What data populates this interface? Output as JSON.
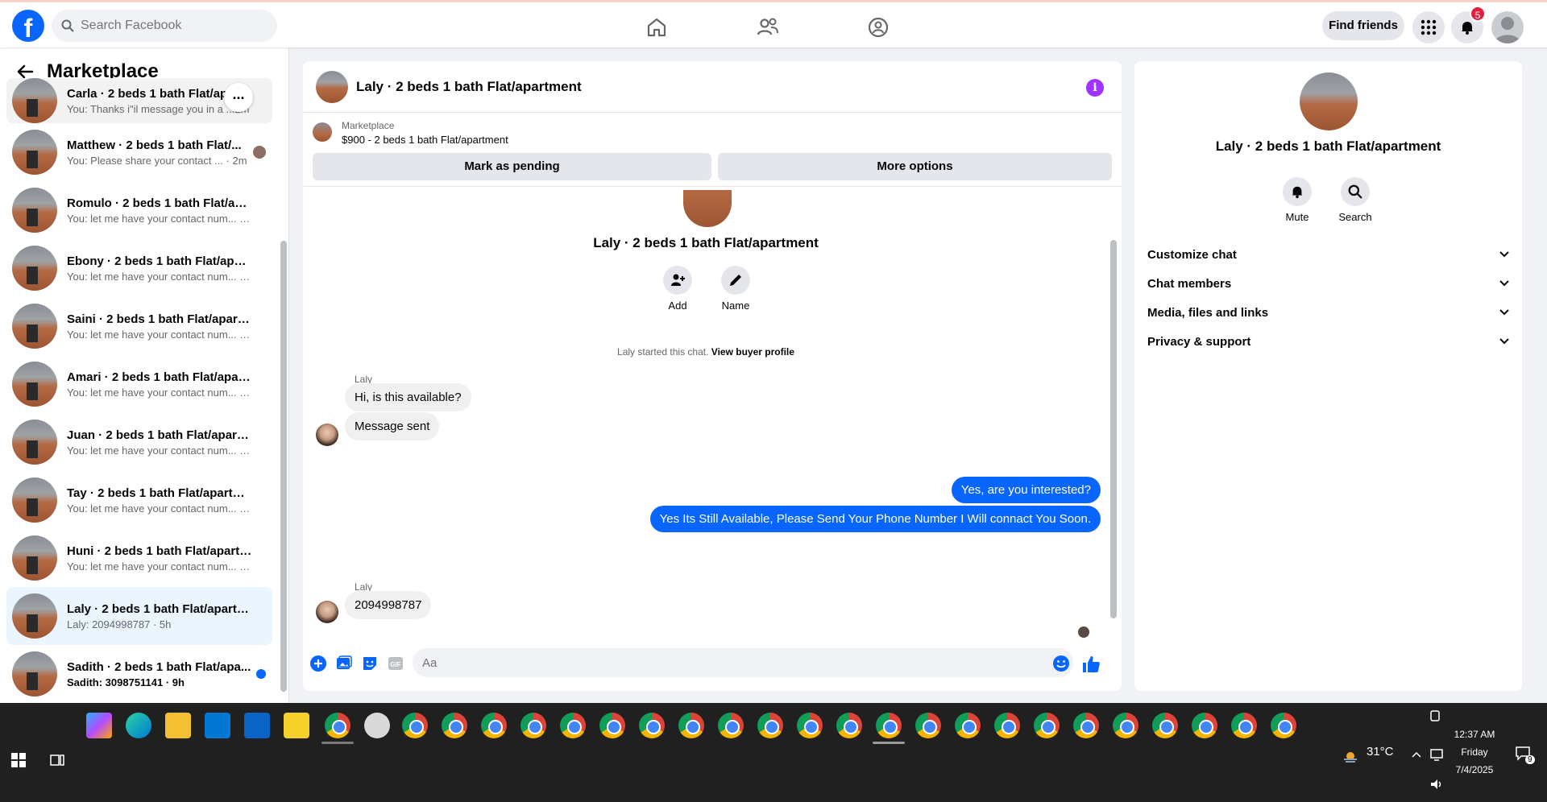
{
  "topbar": {
    "search_placeholder": "Search Facebook",
    "find_friends": "Find friends",
    "notification_count": "5",
    "logo_letter": "f"
  },
  "sidebar": {
    "title": "Marketplace",
    "conversations": [
      {
        "title": "Carla · 2 beds 1 bath Flat/apar...",
        "sub": "You: Thanks i\"il message you in a ...2m"
      },
      {
        "title": "Matthew · 2 beds 1 bath Flat/...",
        "sub": "You: Please share your contact ... · 2m"
      },
      {
        "title": "Romulo · 2 beds 1 bath Flat/apar...",
        "sub": "You: let me have your contact num... · 2m"
      },
      {
        "title": "Ebony · 2 beds 1 bath Flat/apart...",
        "sub": "You: let me have your contact num... · 2m"
      },
      {
        "title": "Saini · 2 beds 1 bath Flat/apartm...",
        "sub": "You: let me have your contact num... · 2m"
      },
      {
        "title": "Amari · 2 beds 1 bath Flat/apart...",
        "sub": "You: let me have your contact num... · 2m"
      },
      {
        "title": "Juan · 2 beds 1 bath Flat/apartm...",
        "sub": "You: let me have your contact num... · 2m"
      },
      {
        "title": "Tay · 2 beds 1 bath Flat/apartment",
        "sub": "You: let me have your contact num... · 2m"
      },
      {
        "title": "Huni · 2 beds 1 bath Flat/apartm...",
        "sub": "You: let me have your contact num... · 2m"
      },
      {
        "title": "Laly · 2 beds 1 bath Flat/apartm...",
        "sub": "Laly: 2094998787 · 5h"
      },
      {
        "title": "Sadith · 2 beds 1 bath Flat/apa...",
        "sub": "Sadith: 3098751141 · 9h"
      }
    ],
    "more_label": "..."
  },
  "chat": {
    "header_name": "Laly · 2 beds 1 bath Flat/apartment",
    "marketplace_label": "Marketplace",
    "listing": "$900 - 2 beds 1 bath Flat/apartment",
    "mark_pending": "Mark as pending",
    "more_options": "More options",
    "thread_name": "Laly · 2 beds 1 bath Flat/apartment",
    "actions": {
      "add": "Add",
      "name": "Name"
    },
    "system_note": "Laly started this chat.",
    "system_link": "View buyer profile",
    "messages": {
      "sender1": "Laly",
      "in1": "Hi, is this available?",
      "in2": "Message sent",
      "out1": "Yes, are you interested?",
      "out2": "Yes Its Still Available, Please Send Your Phone Number I Will connact You Soon.",
      "sender2": "Laly",
      "in3": "2094998787"
    },
    "input_placeholder": "Aa"
  },
  "rightpanel": {
    "name": "Laly · 2 beds 1 bath Flat/apartment",
    "mute": "Mute",
    "search": "Search",
    "sections": [
      "Customize chat",
      "Chat members",
      "Media, files and links",
      "Privacy & support"
    ]
  },
  "taskbar": {
    "temperature": "31°C",
    "time": "12:37 AM",
    "day": "Friday",
    "date": "7/4/2025",
    "notif_count": "9"
  },
  "colors": {
    "brand": "#0866ff",
    "accent_info": "#a033ff",
    "badge": "#e41e3f"
  }
}
